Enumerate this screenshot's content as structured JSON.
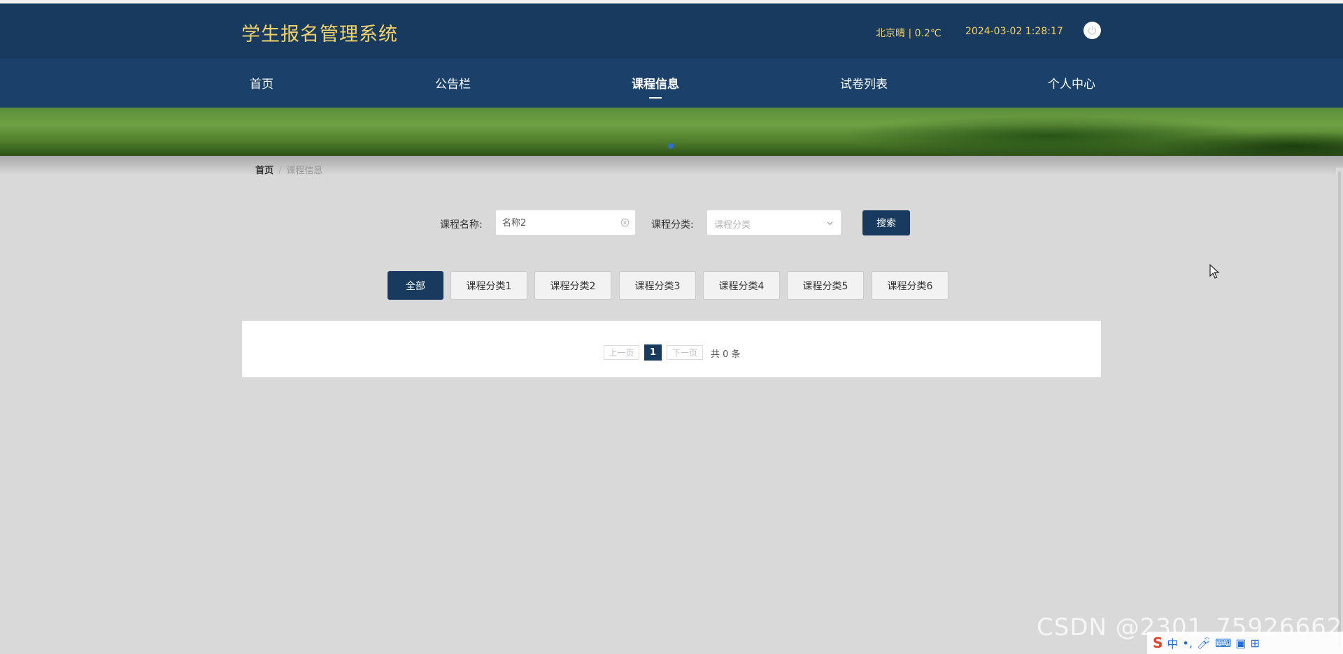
{
  "header": {
    "site_title": "学生报名管理系统",
    "weather": "北京晴 | 0.2℃",
    "datetime": "2024-03-02   1:28:17",
    "power_icon": "power-icon"
  },
  "nav": {
    "items": [
      {
        "label": "首页"
      },
      {
        "label": "公告栏"
      },
      {
        "label": "课程信息",
        "active": true
      },
      {
        "label": "试卷列表"
      },
      {
        "label": "个人中心"
      }
    ]
  },
  "breadcrumb": {
    "home": "首页",
    "separator": "/",
    "current": "课程信息"
  },
  "search": {
    "name_label": "课程名称:",
    "name_value": "名称2",
    "category_label": "课程分类:",
    "category_placeholder": "课程分类",
    "button_label": "搜索"
  },
  "categories": [
    {
      "label": "全部",
      "active": true
    },
    {
      "label": "课程分类1"
    },
    {
      "label": "课程分类2"
    },
    {
      "label": "课程分类3"
    },
    {
      "label": "课程分类4"
    },
    {
      "label": "课程分类5"
    },
    {
      "label": "课程分类6"
    }
  ],
  "pagination": {
    "prev": "上一页",
    "current": "1",
    "next": "下一页",
    "total": "共 0 条"
  },
  "watermark": "CSDN @2301_75926662",
  "ime": {
    "logo": "S",
    "mode": "中"
  },
  "colors": {
    "header_bg": "#183a5e",
    "nav_bg": "#1a4169",
    "accent": "#173a5e",
    "title_gold": "#f2d36b"
  }
}
